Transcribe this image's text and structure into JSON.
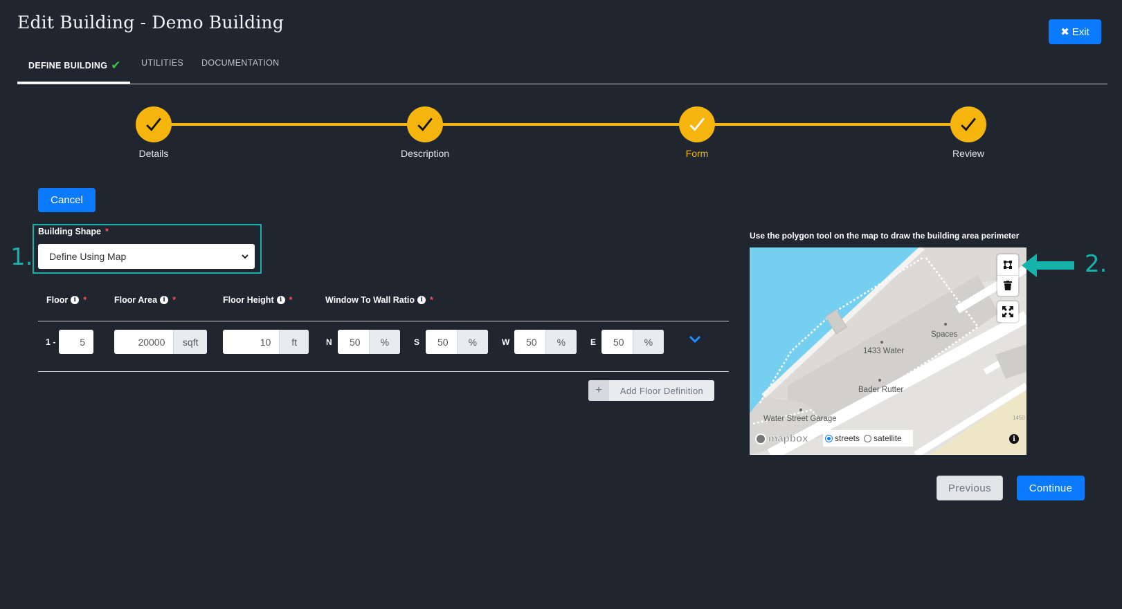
{
  "header": {
    "title": "Edit Building - Demo Building",
    "exit_label": "Exit"
  },
  "tabs": [
    {
      "label": "DEFINE BUILDING",
      "active": true
    },
    {
      "label": "UTILITIES",
      "active": false
    },
    {
      "label": "DOCUMENTATION",
      "active": false
    }
  ],
  "stepper": {
    "color": "#f5b50c",
    "steps": [
      {
        "label": "Details"
      },
      {
        "label": "Description"
      },
      {
        "label": "Form",
        "current": true
      },
      {
        "label": "Review"
      }
    ]
  },
  "form": {
    "cancel_label": "Cancel",
    "building_shape": {
      "label": "Building Shape",
      "required_mark": "*",
      "selected": "Define Using Map"
    },
    "annotations": {
      "one": "1.",
      "two": "2."
    },
    "columns": {
      "floor": "Floor",
      "floor_area": "Floor Area",
      "floor_height": "Floor Height",
      "wwr": "Window To Wall Ratio",
      "required_mark": "*"
    },
    "row": {
      "floor_prefix": "1 -",
      "floor": "5",
      "area": "20000",
      "area_unit": "sqft",
      "height": "10",
      "height_unit": "ft",
      "n_label": "N",
      "n": "50",
      "s_label": "S",
      "s": "50",
      "w_label": "W",
      "w": "50",
      "e_label": "E",
      "e": "50",
      "pct": "%"
    },
    "add_floor_label": "Add Floor Definition"
  },
  "map": {
    "instruction": "Use the polygon tool on the map to draw the building area perimeter",
    "labels": {
      "spaces": "Spaces",
      "water": "1433 Water",
      "bader": "Bader Rutter",
      "garage": "Water Street Garage",
      "num": "1450"
    },
    "brand": "mapbox",
    "style_options": [
      {
        "label": "streets",
        "checked": true
      },
      {
        "label": "satellite",
        "checked": false
      }
    ],
    "water_color": "#75cff0"
  },
  "footer": {
    "previous_label": "Previous",
    "continue_label": "Continue"
  }
}
